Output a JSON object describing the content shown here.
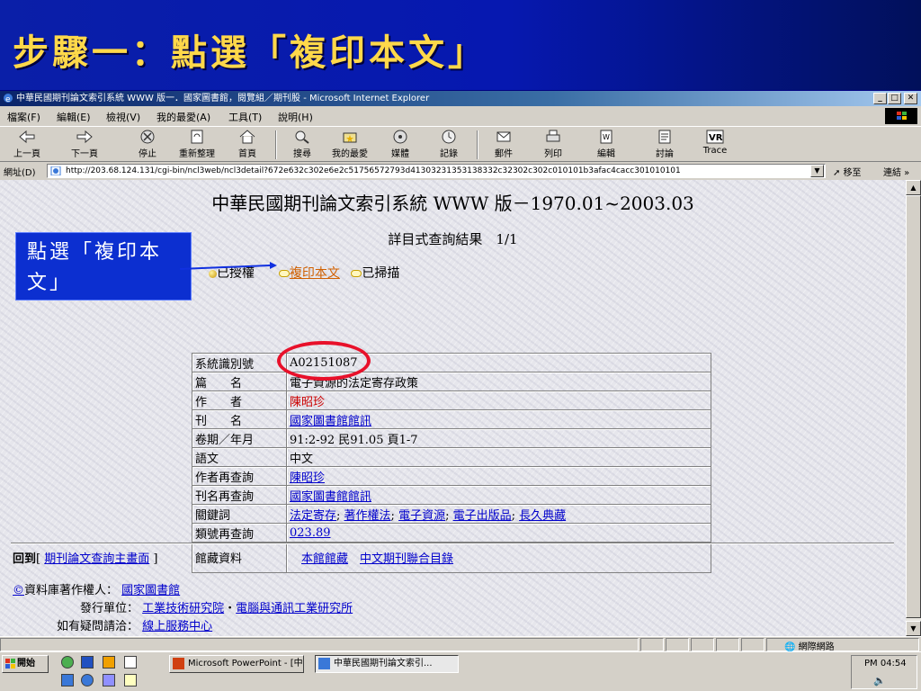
{
  "slide": {
    "title": "步驟一：點選「複印本文」"
  },
  "window": {
    "title": "中華民國期刊論文索引系統 WWW 版一．國家圖書館，閱覽組／期刊股 - Microsoft Internet Explorer",
    "minimize": "_",
    "maximize": "□",
    "close": "✕"
  },
  "menu": [
    "檔案(F)",
    "編輯(E)",
    "檢視(V)",
    "我的最愛(A)",
    "工具(T)",
    "說明(H)"
  ],
  "toolbar": {
    "back": "上一頁",
    "forward": "下一頁",
    "stop": "停止",
    "refresh": "重新整理",
    "home": "首頁",
    "search": "搜尋",
    "favorites": "我的最愛",
    "media": "媒體",
    "history": "記錄",
    "mail": "郵件",
    "print": "列印",
    "edit": "編輯",
    "discuss": "討論",
    "trace": "Trace"
  },
  "address": {
    "label": "網址(D)",
    "url": "http://203.68.124.131/cgi-bin/ncl3web/ncl3detail?672e632c302e6e2c51756572793d41303231353138332c32302c302c010101b3afac4cacc301010101",
    "go": "移至",
    "links": "連結 »"
  },
  "page": {
    "heading": "中華民國期刊論文索引系統 WWW 版－1970.01~2003.03",
    "result_caption": "詳目式查詢結果　1/1",
    "status": {
      "authorized": "已授權",
      "copy_text": "複印本文",
      "scanned": "已掃描"
    },
    "rows": [
      {
        "label": "系統識別號",
        "value": "A02151087"
      },
      {
        "label": "篇　　名",
        "value": "電子資源的法定寄存政策"
      },
      {
        "label": "作　　者",
        "value": "陳昭珍"
      },
      {
        "label": "刊　　名",
        "value": "國家圖書館館訊"
      },
      {
        "label": "卷期／年月",
        "value": "91:2-92 民91.05 頁1-7"
      },
      {
        "label": "語文",
        "value": "中文"
      },
      {
        "label": "作者再查詢",
        "value": "陳昭珍"
      },
      {
        "label": "刊名再查詢",
        "value": "國家圖書館館訊"
      },
      {
        "label": "關鍵詞",
        "keywords": [
          "法定寄存",
          "著作權法",
          "電子資源",
          "電子出版品",
          "長久典藏"
        ]
      },
      {
        "label": "類號再查詢",
        "value": "023.89"
      },
      {
        "label": "館藏資料",
        "holdings": [
          "本館館藏",
          "中文期刊聯合目錄"
        ]
      }
    ],
    "back": {
      "label": "回到",
      "link": "期刊論文查詢主畫面"
    },
    "footer": {
      "copyright_label": "資料庫著作權人：",
      "copyright_value": "國家圖書館",
      "publisher_label": "發行單位：",
      "publisher_1": "工業技術研究院",
      "publisher_2": "電腦與通訊工業研究所",
      "contact_label": "如有疑問請洽：",
      "contact_value": "線上服務中心"
    }
  },
  "callout": {
    "text": "點選「複印本文」"
  },
  "statusbar": {
    "zone": "網際網路"
  },
  "taskbar": {
    "start": "開始",
    "tasks": [
      "Microsoft PowerPoint - [中",
      "中華民國期刊論文索引..."
    ],
    "clock": "PM 04:54"
  }
}
